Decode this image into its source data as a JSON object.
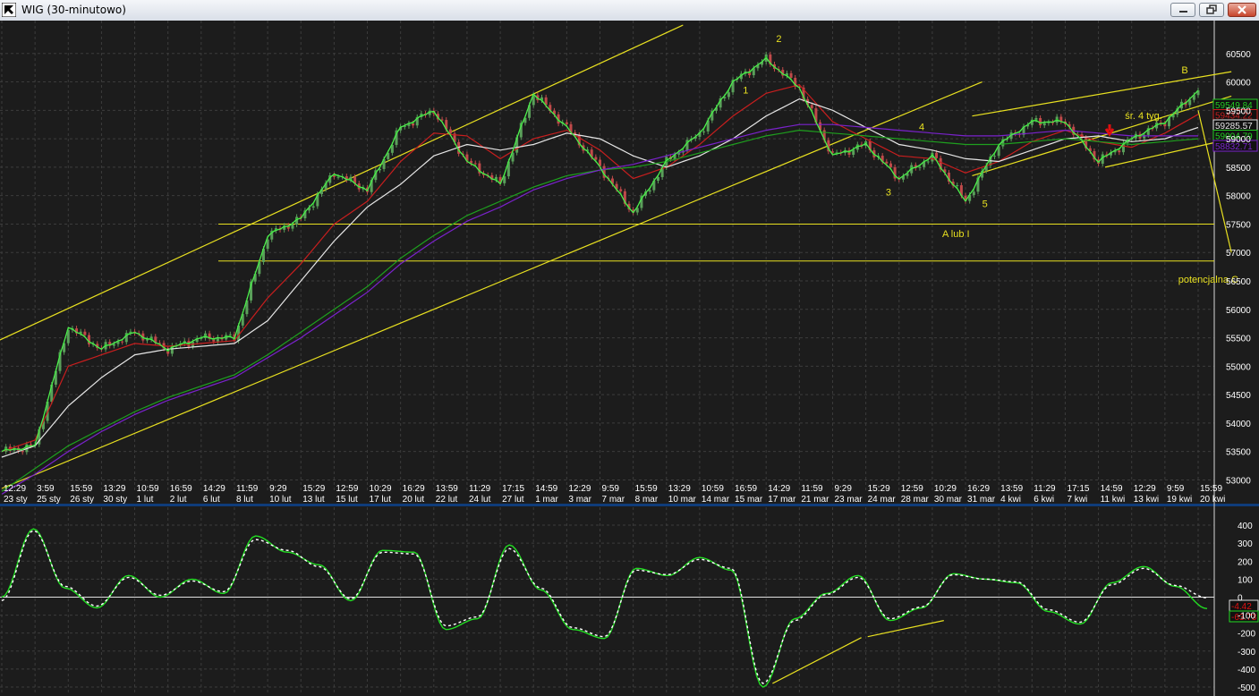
{
  "window": {
    "title": "WIG (30-minutowo)"
  },
  "colors": {
    "background": "#1c1c1c",
    "grid": "#3c3c3c",
    "price_up": "#5aa05a",
    "price_down": "#c04a4a",
    "ma_fast": "#22cc22",
    "ma_red": "#c81e1e",
    "ma_white": "#e6e6e6",
    "ma_green_slow": "#1ea01e",
    "ma_violet": "#7a22cc",
    "channel": "#e8e020",
    "oscillator": "#22dd22",
    "oscillator_signal": "#ffffff",
    "axis_text": "#ffffff",
    "annotation": "#e8e020"
  },
  "chart_data": [
    {
      "type": "line",
      "title": "",
      "xlabel": "",
      "ylabel": "",
      "y_ticks": [
        53000,
        53500,
        54000,
        54500,
        55000,
        55500,
        56000,
        56500,
        57000,
        57500,
        58000,
        58500,
        59000,
        59500,
        60000,
        60500
      ],
      "y_tick_labels": [
        "53000",
        "53500",
        "54000",
        "54500",
        "55000",
        "55500",
        "56000",
        "56500",
        "57000",
        "57500",
        "58000",
        "58500",
        "59000",
        "59500",
        "60000",
        "60500"
      ],
      "ylim": [
        52850,
        61000
      ],
      "x_categories": [
        "12:29",
        "3:59",
        "15:59",
        "13:29",
        "10:59",
        "16:59",
        "14:29",
        "11:59",
        "9:29",
        "15:29",
        "12:59",
        "10:29",
        "16:29",
        "13:59",
        "11:29",
        "17:15",
        "14:59",
        "12:29",
        "9:59",
        "15:59",
        "13:29",
        "10:59",
        "16:59",
        "14:29",
        "11:59",
        "9:29",
        "15:29",
        "12:59",
        "10:29",
        "16:29",
        "13:59",
        "11:29",
        "17:15",
        "14:59",
        "12:29",
        "9:59",
        "15:59"
      ],
      "x_dates": [
        "23 sty",
        "25 sty",
        "26 sty",
        "30 sty",
        "1 lut",
        "2 lut",
        "6 lut",
        "8 lut",
        "10 lut",
        "13 lut",
        "15 lut",
        "17 lut",
        "20 lut",
        "22 lut",
        "24 lut",
        "27 lut",
        "1 mar",
        "3 mar",
        "7 mar",
        "8 mar",
        "10 mar",
        "14 mar",
        "15 mar",
        "17 mar",
        "21 mar",
        "23 mar",
        "24 mar",
        "28 mar",
        "30 mar",
        "31 mar",
        "4 kwi",
        "6 kwi",
        "7 kwi",
        "11 kwi",
        "13 kwi",
        "19 kwi",
        "20 kwi"
      ],
      "series": [
        {
          "role": "price",
          "values": [
            53500,
            53600,
            55700,
            55300,
            55600,
            55300,
            55500,
            55500,
            57300,
            57600,
            58400,
            58100,
            59200,
            59500,
            58600,
            58200,
            59800,
            59200,
            58500,
            57700,
            58600,
            59100,
            60000,
            60400,
            59900,
            58700,
            58900,
            58300,
            58700,
            57900,
            58900,
            59300,
            59300,
            58600,
            59000,
            59300,
            59850
          ]
        },
        {
          "role": "ma_red",
          "values": [
            53500,
            53700,
            55000,
            55200,
            55400,
            55350,
            55400,
            55450,
            56200,
            56800,
            57500,
            57900,
            58600,
            59100,
            59050,
            58650,
            59000,
            59150,
            58800,
            58300,
            58500,
            58900,
            59400,
            59800,
            59950,
            59300,
            59000,
            58700,
            58650,
            58400,
            58600,
            58950,
            59150,
            58950,
            58850,
            59100,
            59430
          ]
        },
        {
          "role": "ma_white",
          "values": [
            53400,
            53600,
            54300,
            54800,
            55200,
            55300,
            55350,
            55400,
            55800,
            56500,
            57200,
            57800,
            58200,
            58700,
            58900,
            58800,
            58900,
            59100,
            59000,
            58700,
            58500,
            58700,
            59000,
            59400,
            59700,
            59500,
            59200,
            58900,
            58800,
            58650,
            58600,
            58800,
            59000,
            59050,
            58950,
            59000,
            59200
          ]
        },
        {
          "role": "ma_green_slow",
          "values": [
            52800,
            53200,
            53600,
            53900,
            54200,
            54450,
            54650,
            54850,
            55200,
            55600,
            56000,
            56400,
            56900,
            57300,
            57650,
            57900,
            58150,
            58350,
            58450,
            58500,
            58600,
            58750,
            58900,
            59050,
            59150,
            59100,
            59050,
            59000,
            58950,
            58900,
            58900,
            58950,
            59000,
            58950,
            58900,
            58950,
            59000
          ]
        },
        {
          "role": "ma_violet",
          "values": [
            52750,
            53100,
            53500,
            53850,
            54150,
            54400,
            54600,
            54800,
            55150,
            55500,
            55900,
            56300,
            56800,
            57200,
            57550,
            57800,
            58100,
            58300,
            58450,
            58550,
            58700,
            58850,
            59000,
            59150,
            59250,
            59250,
            59200,
            59150,
            59100,
            59050,
            59050,
            59100,
            59150,
            59100,
            59050,
            59050,
            59050
          ]
        }
      ],
      "horizontal_lines": [
        57500,
        56850
      ],
      "price_labels": [
        "59549.84",
        "59434.22",
        "59285.57",
        "59004.79",
        "58832.71"
      ],
      "annotations": [
        "2",
        "1",
        "4",
        "3",
        "5",
        "B",
        "A lub I",
        "potencjalna C",
        "śr. 4 tyg."
      ]
    },
    {
      "type": "line",
      "title": "",
      "y_ticks": [
        400,
        300,
        200,
        100,
        0,
        -100,
        -200,
        -300,
        -400,
        -500
      ],
      "y_tick_labels": [
        "400",
        "300",
        "200",
        "100",
        "0",
        "-100",
        "-200",
        "-300",
        "-400",
        "-500"
      ],
      "ylim": [
        -520,
        460
      ],
      "series": [
        {
          "role": "oscillator",
          "values": [
            0,
            380,
            50,
            -60,
            120,
            0,
            100,
            20,
            340,
            250,
            180,
            -20,
            260,
            250,
            -180,
            -120,
            290,
            40,
            -180,
            -230,
            160,
            120,
            220,
            150,
            -500,
            -120,
            20,
            120,
            -130,
            -60,
            130,
            100,
            80,
            -80,
            -150,
            80,
            170,
            60,
            -64
          ]
        },
        {
          "role": "signal",
          "values": [
            -20,
            370,
            60,
            -50,
            110,
            10,
            90,
            30,
            320,
            260,
            170,
            -10,
            250,
            240,
            -160,
            -110,
            270,
            50,
            -170,
            -220,
            150,
            125,
            210,
            160,
            -480,
            -130,
            15,
            110,
            -120,
            -55,
            125,
            100,
            85,
            -70,
            -140,
            70,
            160,
            65,
            -4
          ]
        }
      ],
      "value_labels": [
        "-4.42",
        "-63.73"
      ]
    }
  ]
}
